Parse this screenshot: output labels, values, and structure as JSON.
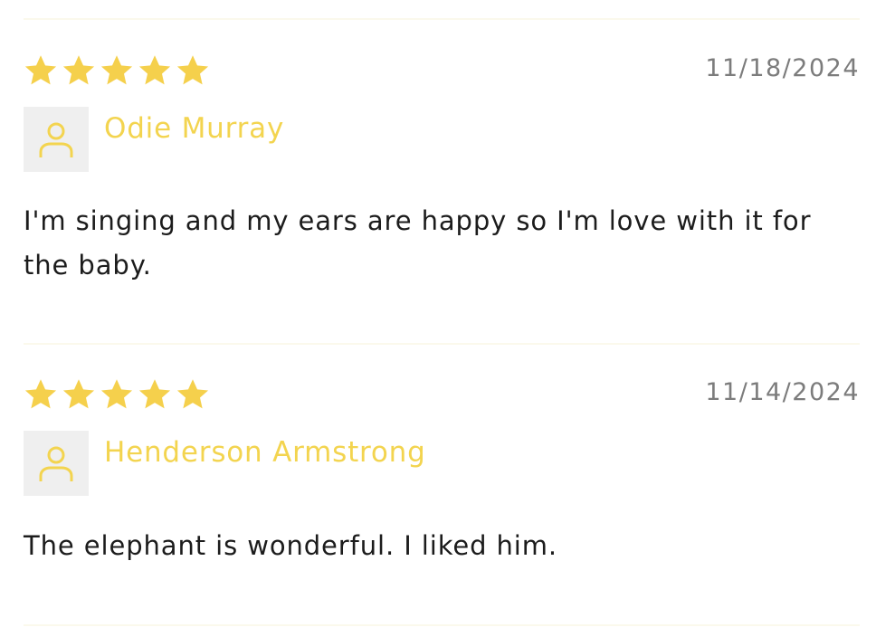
{
  "colors": {
    "star": "#f5d04c",
    "author": "#f3d44f",
    "date": "#7c7c7c",
    "text": "#1c1c1c",
    "avatar_bg": "#efefef",
    "divider": "#fbf9ec"
  },
  "reviews": [
    {
      "rating": 5,
      "max_rating": 5,
      "date": "11/18/2024",
      "author": "Odie Murray",
      "avatar_icon": "user-outline-icon",
      "body": "I'm singing and my ears are happy so I'm love with it for the baby."
    },
    {
      "rating": 5,
      "max_rating": 5,
      "date": "11/14/2024",
      "author": "Henderson Armstrong",
      "avatar_icon": "user-outline-icon",
      "body": "The elephant is wonderful. I liked him."
    }
  ]
}
